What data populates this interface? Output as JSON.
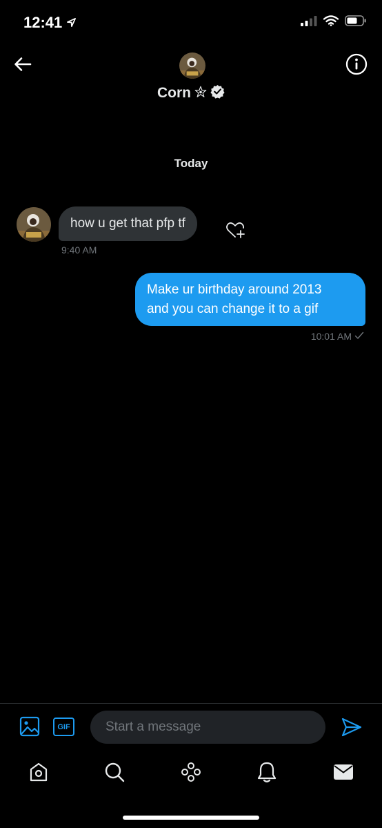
{
  "status_bar": {
    "time": "12:41",
    "icons": [
      "location-arrow-icon",
      "cellular-signal-icon",
      "wifi-icon",
      "battery-icon"
    ]
  },
  "header": {
    "contact_name": "Corn",
    "name_badge_icon": "star-badge-icon",
    "verified_icon": "verified-badge-icon",
    "back_icon": "arrow-left-icon",
    "info_icon": "info-circle-icon"
  },
  "conversation": {
    "day_label": "Today",
    "messages": [
      {
        "direction": "received",
        "text": "how u get that pfp tf",
        "time": "9:40 AM"
      },
      {
        "direction": "sent",
        "lines": [
          "Make ur birthday around 2013",
          "and you can change it to a gif"
        ],
        "time": "10:01 AM"
      }
    ]
  },
  "compose": {
    "placeholder": "Start a message",
    "gif_label": "GIF"
  },
  "tab_bar": {
    "tabs": [
      "home",
      "search",
      "spaces",
      "notifications",
      "messages"
    ],
    "active": "messages"
  },
  "colors": {
    "background": "#000000",
    "accent": "#1d9bf0",
    "received_bubble": "#2f3336",
    "muted_text": "#71767b",
    "input_bg": "#202327"
  }
}
